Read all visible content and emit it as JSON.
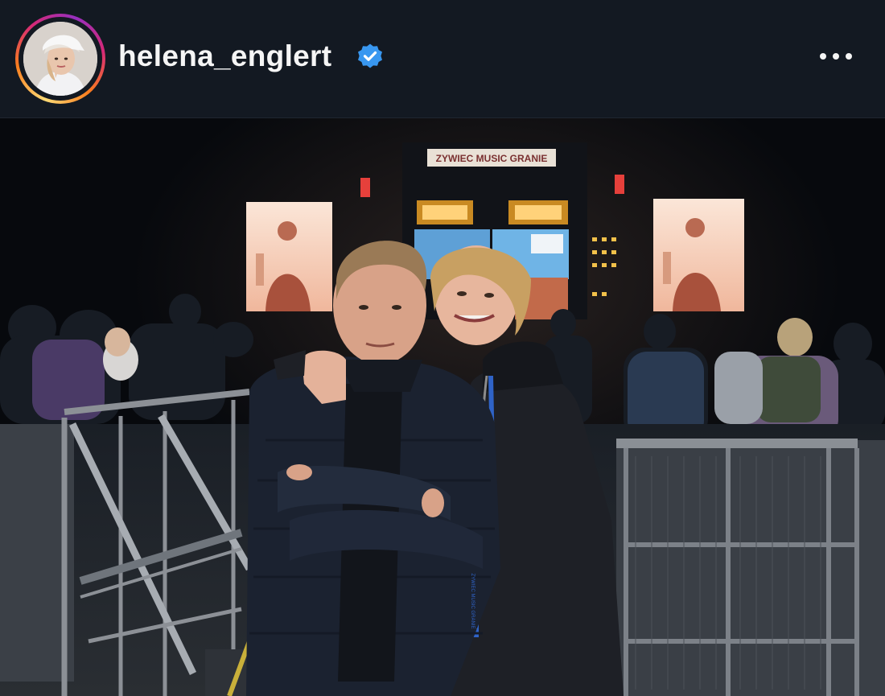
{
  "post_header": {
    "username": "helena_englert",
    "verified": true,
    "verified_icon": "verified-badge-icon",
    "verified_color": "#3897f0",
    "more_icon": "more-options-icon",
    "story_ring_colors": [
      "#feda75",
      "#fa7e1e",
      "#d62976",
      "#962fbf"
    ]
  },
  "photo": {
    "stage_sign_text": "ZYWIEC MUSIC GRANIE",
    "lanyard_text": "ZYWIEC MUSIC GRANIE"
  }
}
